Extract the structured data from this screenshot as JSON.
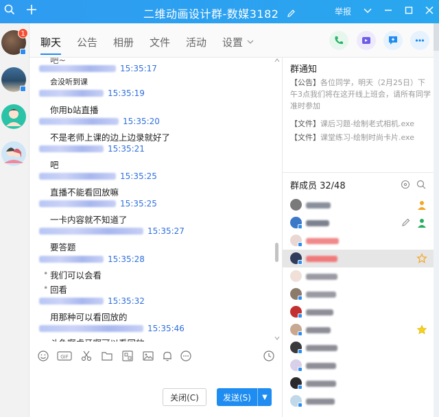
{
  "window": {
    "title": "二维动画设计群-数媒3182",
    "report_label": "举报"
  },
  "rail": {
    "badge_count": "1"
  },
  "tabs": [
    {
      "label": "聊天",
      "active": true
    },
    {
      "label": "公告",
      "active": false
    },
    {
      "label": "相册",
      "active": false
    },
    {
      "label": "文件",
      "active": false
    },
    {
      "label": "活动",
      "active": false
    },
    {
      "label": "设置",
      "active": false
    }
  ],
  "chat": {
    "top_partial_text": "吧~",
    "messages": [
      {
        "time": "15:35:17",
        "text": "会没听到课",
        "small": true
      },
      {
        "time": "15:35:19",
        "text": "你用b站直播"
      },
      {
        "time": "15:35:20",
        "text": "不是老师上课的边上边录就好了"
      },
      {
        "time": "15:35:21",
        "text": "吧"
      },
      {
        "time": "15:35:25",
        "text": "直播不能看回放嘛"
      },
      {
        "time": "15:35:25",
        "text": "一卡内容就不知道了"
      },
      {
        "time": "15:35:27",
        "text": "要答题"
      },
      {
        "time": "15:35:28",
        "text": "我们可以会看",
        "text2": "回看",
        "bullets": true
      },
      {
        "time": "15:35:32",
        "text": "用那种可以看回放的"
      },
      {
        "time": "15:35:46",
        "text": "斗鱼啊虎牙啊可以看回放"
      }
    ]
  },
  "input": {
    "close_label": "关闭(C)",
    "send_label": "发送(S)"
  },
  "notice": {
    "title": "群通知",
    "announcement_tag": "【公告】",
    "announcement_text": "各位同学，明天（2月25日）下午3点我们将在这开线上班会，请所有同学准时参加",
    "files": [
      {
        "tag": "【文件】",
        "name": "课后习题-绘制老式相机.exe"
      },
      {
        "tag": "【文件】",
        "name": "课堂练习-绘制时尚卡片.exe"
      }
    ]
  },
  "members": {
    "title": "群成员 32/48"
  },
  "colors": {
    "accent": "#1e8cf0",
    "titlebar": "#2f9bf0",
    "time": "#2f6fde",
    "badge": "#f74c31"
  }
}
